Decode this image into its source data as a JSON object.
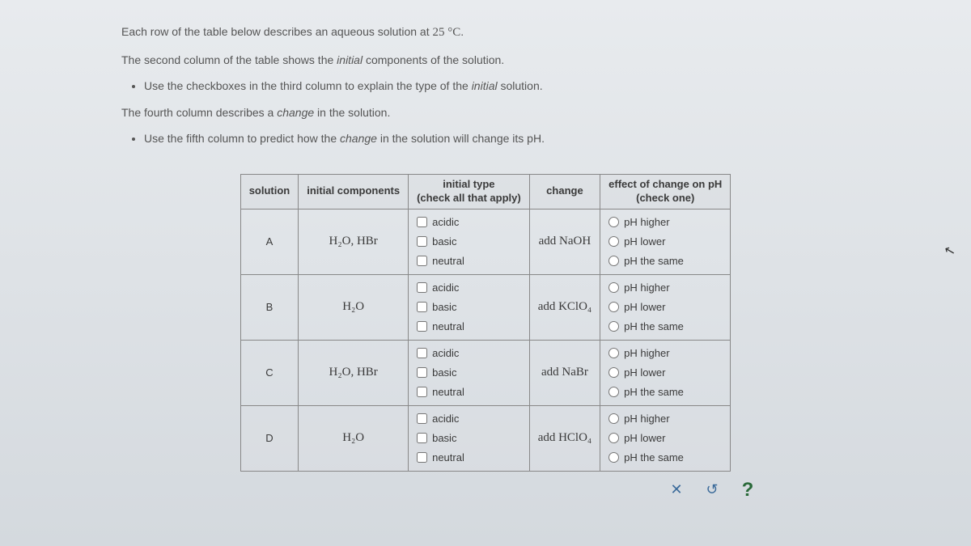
{
  "instructions": {
    "line1_pre": "Each row of the table below describes an aqueous solution at ",
    "line1_temp": "25 °C",
    "line1_post": ".",
    "line2_pre": "The second column of the table shows the ",
    "line2_it": "initial",
    "line2_post": " components of the solution.",
    "bullet1_pre": "Use the checkboxes in the third column to explain the type of the ",
    "bullet1_it": "initial",
    "bullet1_post": " solution.",
    "line3_pre": "The fourth column describes a ",
    "line3_it": "change",
    "line3_post": " in the solution.",
    "bullet2_pre": "Use the fifth column to predict how the ",
    "bullet2_it": "change",
    "bullet2_post": " in the solution will change its pH."
  },
  "headers": {
    "c1": "solution",
    "c2": "initial components",
    "c3a": "initial type",
    "c3b": "(check all that apply)",
    "c4": "change",
    "c5a": "effect of change on pH",
    "c5b": "(check one)"
  },
  "type_opts": {
    "a": "acidic",
    "b": "basic",
    "c": "neutral"
  },
  "effect_opts": {
    "a": "pH higher",
    "b": "pH lower",
    "c": "pH the same"
  },
  "rows": {
    "A": {
      "label": "A",
      "components": "H₂O, HBr",
      "change": "add NaOH"
    },
    "B": {
      "label": "B",
      "components": "H₂O",
      "change": "add KClO₄"
    },
    "C": {
      "label": "C",
      "components": "H₂O, HBr",
      "change": "add NaBr"
    },
    "D": {
      "label": "D",
      "components": "H₂O",
      "change": "add HClO₄"
    }
  },
  "footer": {
    "close": "✕",
    "reset": "↺",
    "help": "?"
  }
}
